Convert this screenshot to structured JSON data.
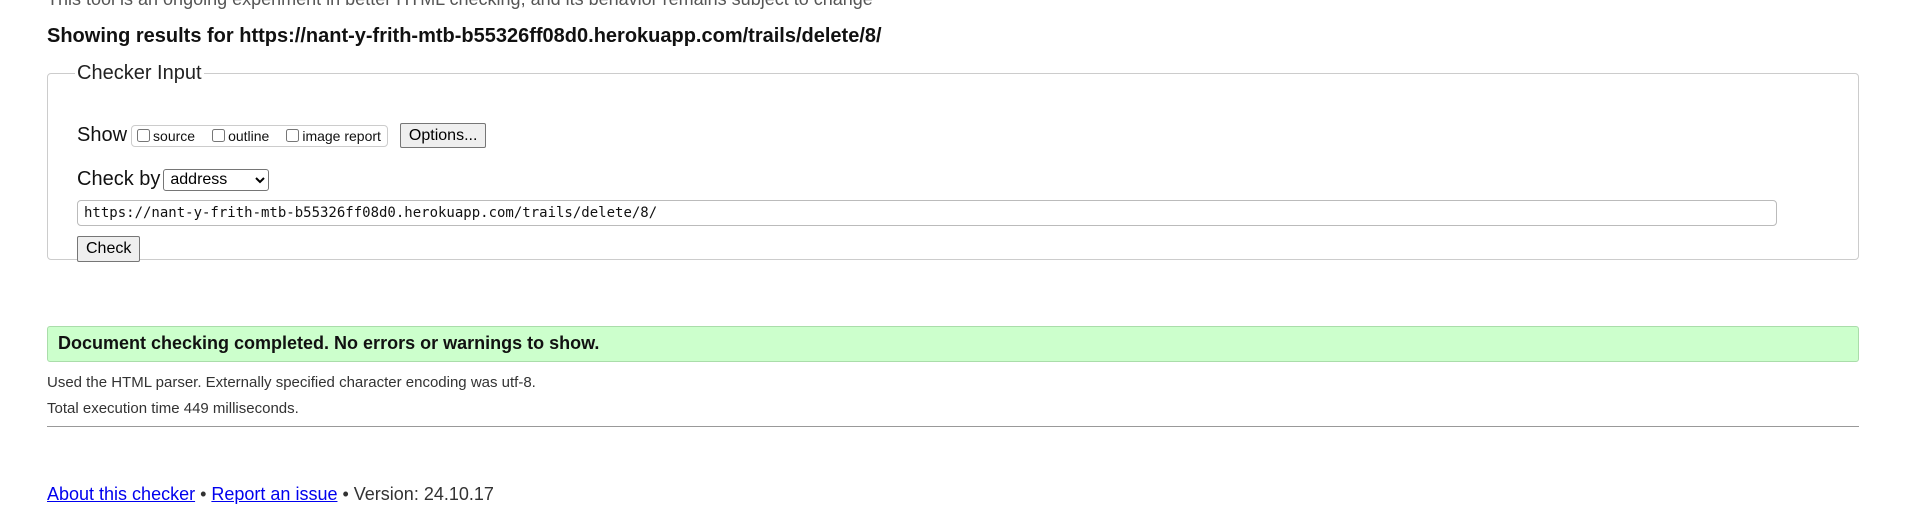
{
  "intro_text": "This tool is an ongoing experiment in better HTML checking, and its behavior remains subject to change",
  "results_heading": "Showing results for https://nant-y-frith-mtb-b55326ff08d0.herokuapp.com/trails/delete/8/",
  "checker": {
    "legend": "Checker Input",
    "show_label": "Show",
    "show_options": [
      "source",
      "outline",
      "image report"
    ],
    "options_button": "Options...",
    "check_by_label": "Check by",
    "check_by_value": "address",
    "url_value": "https://nant-y-frith-mtb-b55326ff08d0.herokuapp.com/trails/delete/8/",
    "check_button": "Check"
  },
  "result": {
    "message": "Document checking completed. No errors or warnings to show.",
    "color": "#ccffcc"
  },
  "details": {
    "parser": "Used the HTML parser. Externally specified character encoding was utf-8.",
    "time": "Total execution time 449 milliseconds."
  },
  "footer": {
    "about_link": "About this checker",
    "sep1": " • ",
    "report_link": "Report an issue",
    "sep2": " • ",
    "version": "Version: 24.10.17",
    "link_color": "#0000ee"
  }
}
